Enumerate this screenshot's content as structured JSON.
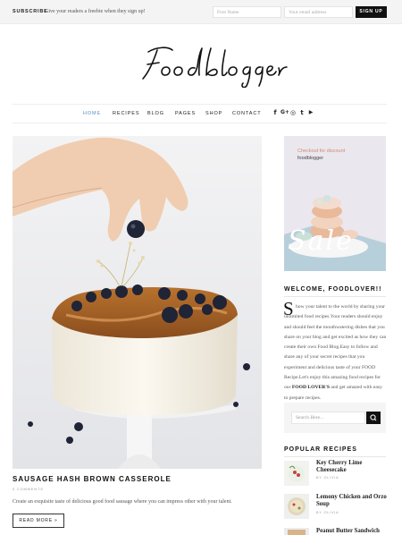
{
  "topbar": {
    "subscribe_label": "SUBSCRIBE",
    "subscribe_text": "Give your readers a freebie when they sign up!",
    "first_name_placeholder": "First Name",
    "email_placeholder": "Your email address",
    "signup_label": "SIGN UP"
  },
  "logo": {
    "text": "Food blogger"
  },
  "nav": {
    "items": [
      "HOME",
      "RECIPES",
      "BLOG",
      "PAGES",
      "SHOP",
      "CONTACT"
    ],
    "active": "HOME",
    "social_icons": [
      "facebook-icon",
      "google-plus-icon",
      "instagram-icon",
      "twitter-icon",
      "youtube-icon"
    ],
    "social_glyphs": [
      "f",
      "G+",
      "◎",
      "t",
      "▶"
    ]
  },
  "post": {
    "title": "SAUSAGE HASH BROWN CASSEROLE",
    "meta": "0 COMMENTS",
    "excerpt": "Create an exquisite taste of delicious good food sausage where you can impress other with your talent.",
    "read_more": "READ MORE »"
  },
  "sidebar": {
    "ad": {
      "line1": "Checkout for discount",
      "line2": "foodblogger",
      "word": "Sale"
    },
    "welcome": {
      "title": "WELCOME, FOODLOVER!!",
      "dropcap": "S",
      "text_before": "how your talent to the world by sharing your unlimited food recipes.Your readers should enjoy and should feel the mouthwatering dishes that you share on your blog and get excited as how they can create their own Food Blog.Easy to follow and share any of your secret recipes that you experiment and delicious taste of your FOOD Recipe.Let's enjoy this amazing food recipes for our",
      "text_bold": "FOOD LOVER'S",
      "text_after": "and get amazed with easy to prepare recipes."
    },
    "search": {
      "placeholder": "Search Here..."
    },
    "popular": {
      "title": "POPULAR RECIPES",
      "items": [
        {
          "title": "Key Cherry Lime Cheesecake",
          "by": "BY OLIVIA"
        },
        {
          "title": "Lemony Chicken and Orzo Soup",
          "by": "BY OLIVIA"
        },
        {
          "title": "Peanut Butter Sandwich",
          "by": ""
        }
      ]
    }
  },
  "colors": {
    "accent": "#5a8bc7",
    "dark": "#111111",
    "topbar_bg": "#f4f4f4"
  }
}
